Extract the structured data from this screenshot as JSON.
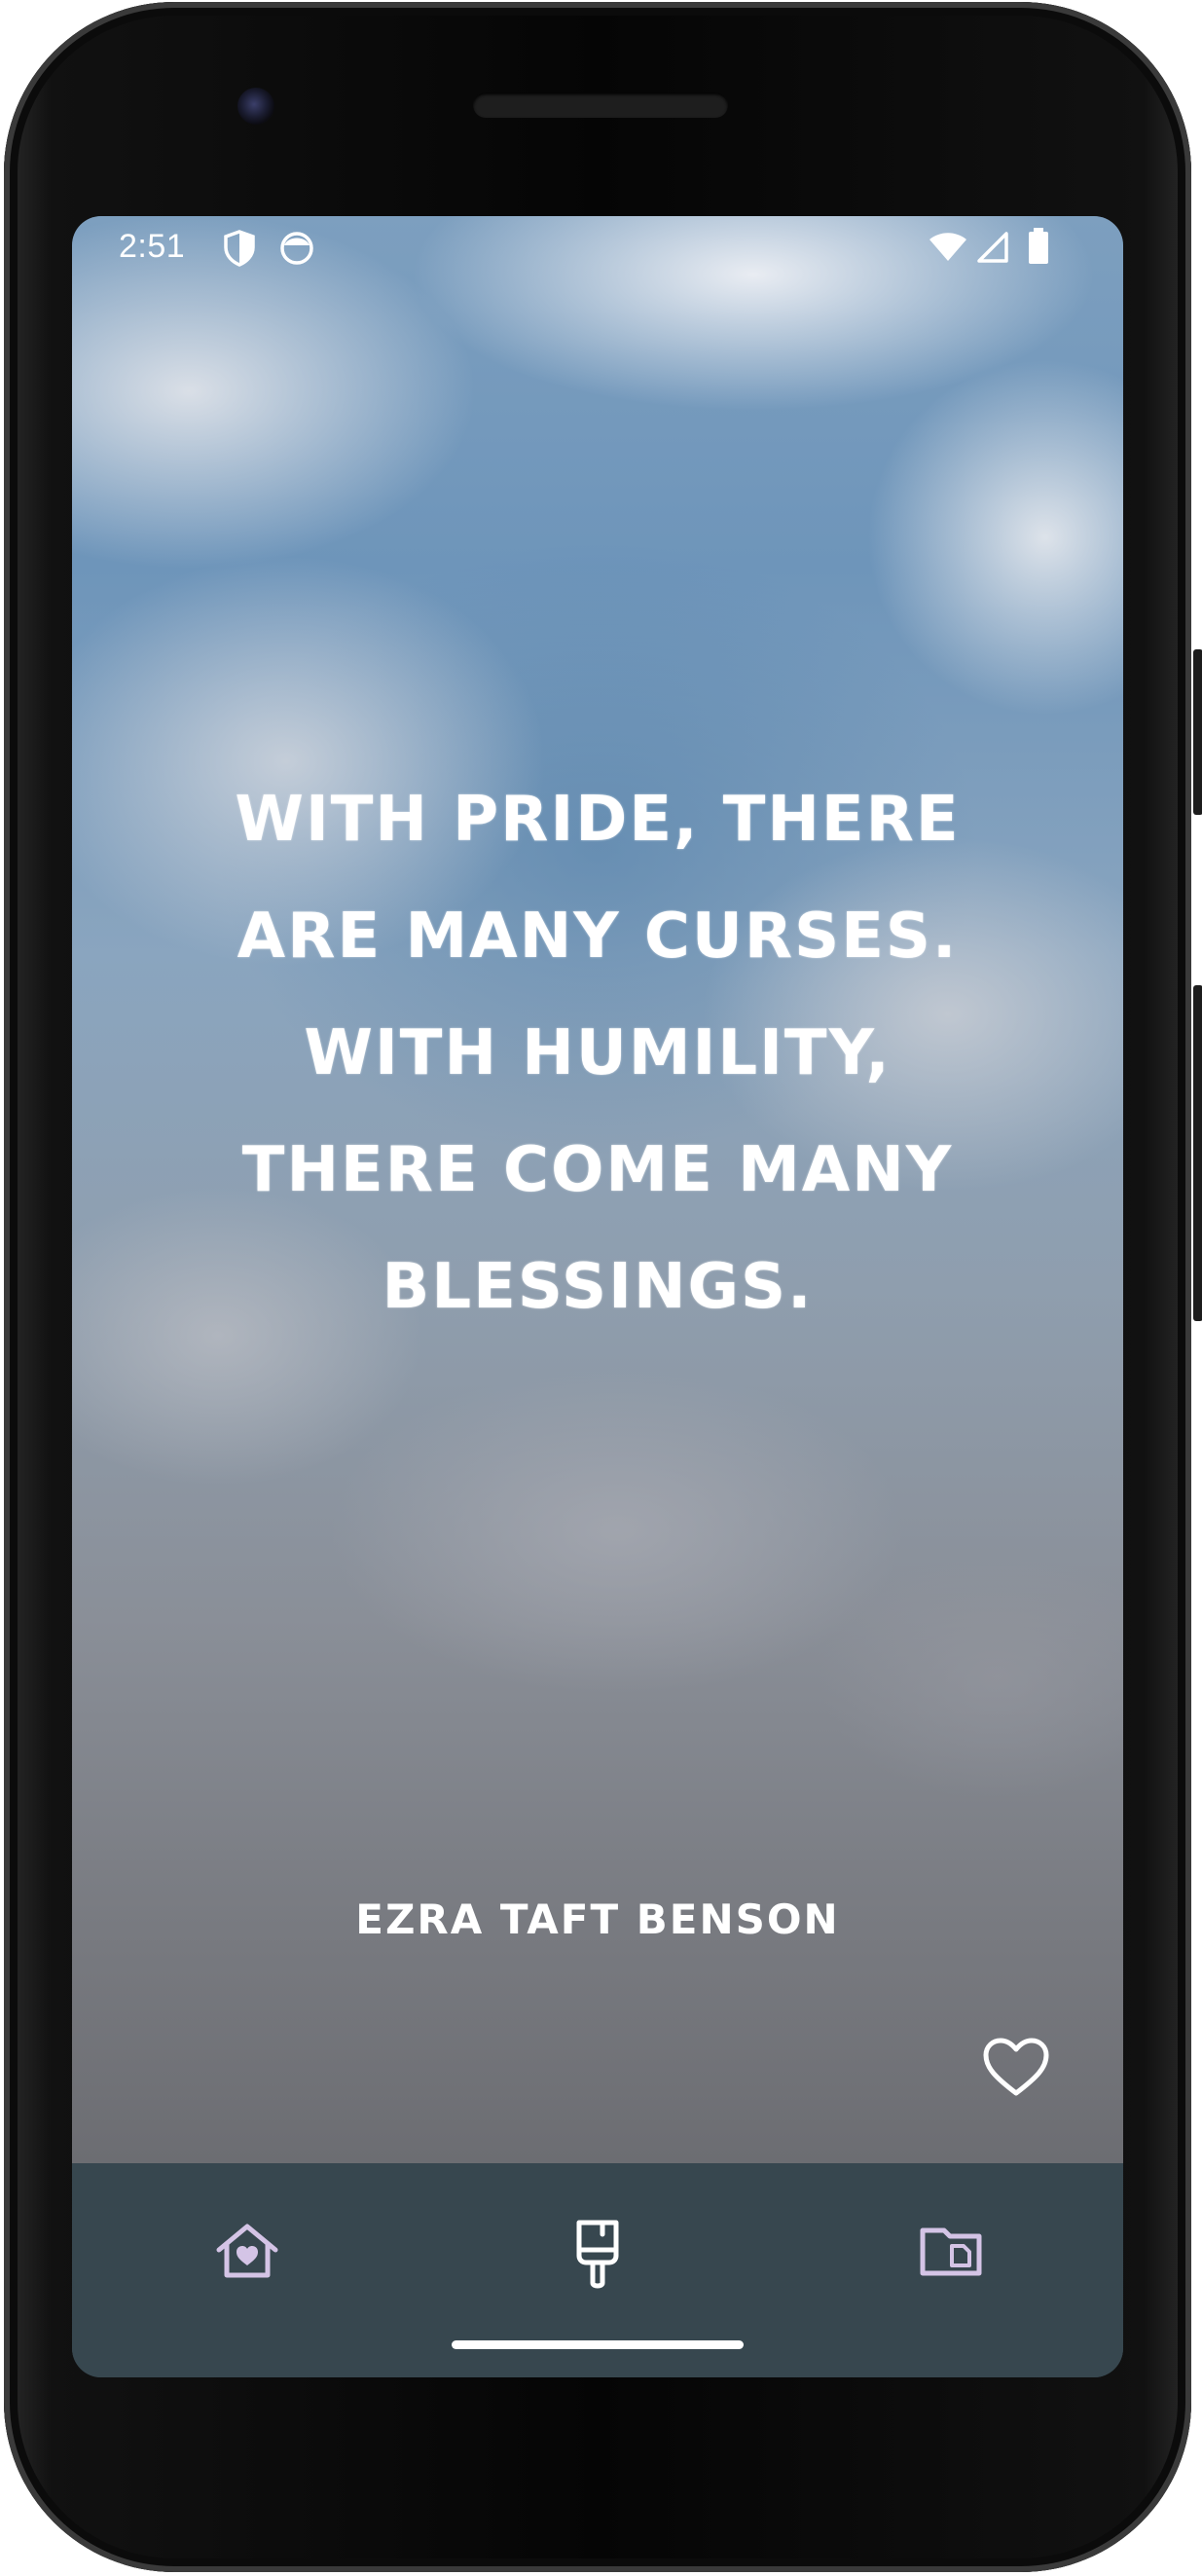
{
  "status_bar": {
    "time": "2:51",
    "left_icons": [
      "shield-icon",
      "face-icon"
    ],
    "right_icons": [
      "wifi-icon",
      "signal-icon",
      "battery-icon"
    ]
  },
  "quote": {
    "text": "With pride, there are many curses. With humility, there come many blessings.",
    "author": "Ezra Taft Benson"
  },
  "actions": {
    "favorite_icon": "heart-outline-icon"
  },
  "bottom_nav": {
    "items": [
      {
        "icon": "home-heart-icon",
        "active": false
      },
      {
        "icon": "brush-icon",
        "active": true
      },
      {
        "icon": "folder-icon",
        "active": false
      }
    ]
  },
  "colors": {
    "nav_background": "#37474f",
    "nav_icon_inactive": "#d4c4e6",
    "nav_icon_active": "#ffffff",
    "text": "#ffffff"
  }
}
